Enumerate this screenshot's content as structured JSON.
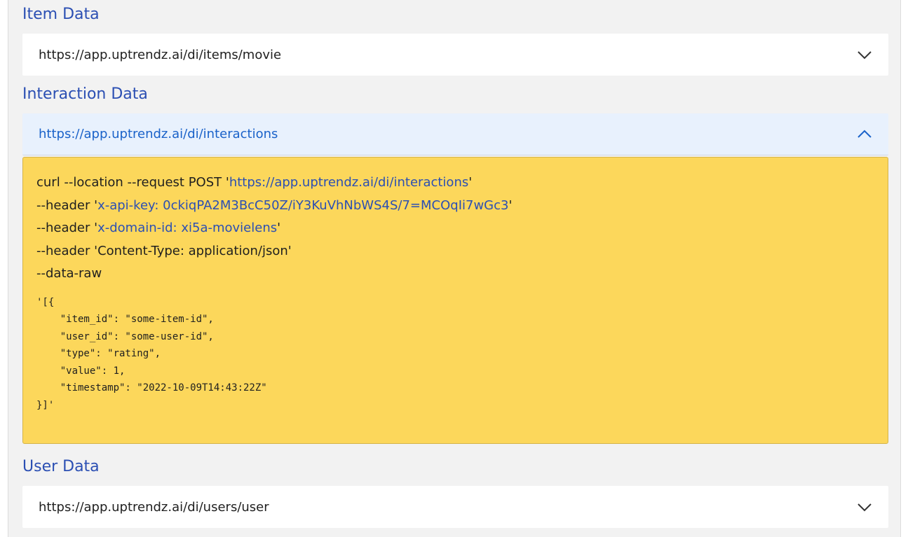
{
  "sections": {
    "item": {
      "title": "Item Data",
      "url": "https://app.uptrendz.ai/di/items/movie",
      "expanded": false
    },
    "interaction": {
      "title": "Interaction Data",
      "url": "https://app.uptrendz.ai/di/interactions",
      "expanded": true,
      "code": {
        "line1_prefix": "curl --location --request POST '",
        "line1_url": "https://app.uptrendz.ai/di/interactions",
        "line1_suffix": "'",
        "line2_prefix": "--header '",
        "line2_value": "x-api-key: 0ckiqPA2M3BcC50Z/iY3KuVhNbWS4S/7=MCOqIi7wGc3",
        "line2_suffix": "'",
        "line3_prefix": "--header '",
        "line3_value": "x-domain-id: xi5a-movielens",
        "line3_suffix": "'",
        "line4": "--header 'Content-Type: application/json'",
        "line5": "--data-raw",
        "json": "'[{\n    \"item_id\": \"some-item-id\",\n    \"user_id\": \"some-user-id\",\n    \"type\": \"rating\",\n    \"value\": 1,\n    \"timestamp\": \"2022-10-09T14:43:22Z\"\n}]'"
      }
    },
    "user": {
      "title": "User Data",
      "url": "https://app.uptrendz.ai/di/users/user",
      "expanded": false
    }
  },
  "colors": {
    "title": "#2b4fb3",
    "link": "#2b4fb3",
    "expanded_header_bg": "#e8f1fd",
    "expanded_url": "#1a62c9",
    "code_bg": "#fcd75b",
    "panel_bg": "#f2f2f2"
  },
  "icons": {
    "collapsed": "chevron-down-icon",
    "expanded": "chevron-up-icon"
  }
}
